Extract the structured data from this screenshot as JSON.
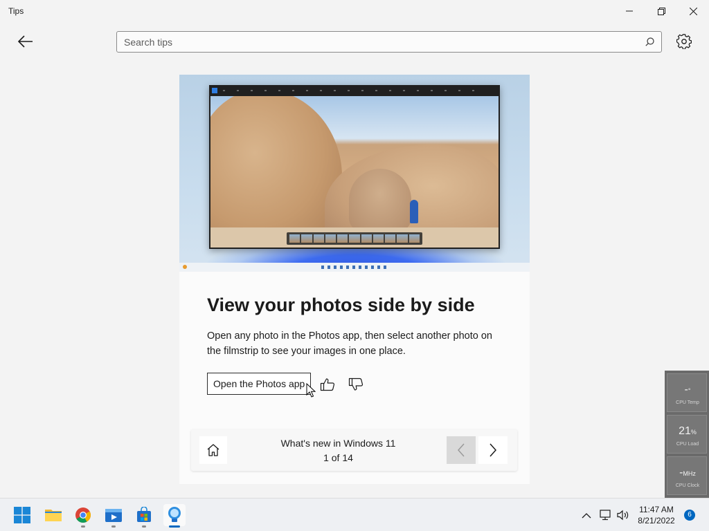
{
  "window": {
    "title": "Tips",
    "minimize_icon": "minimize-icon",
    "restore_icon": "restore-icon",
    "close_icon": "close-icon"
  },
  "appbar": {
    "back_icon": "back-arrow-icon",
    "search_placeholder": "Search tips",
    "search_icon": "search-icon",
    "settings_icon": "gear-icon"
  },
  "card": {
    "hero_image": "photos-app-screenshot",
    "title": "View your photos side by side",
    "description": "Open any photo in the Photos app, then select another photo on the filmstrip to see your images in one place.",
    "action_label": "Open the Photos app",
    "like_icon": "thumbs-up-icon",
    "dislike_icon": "thumbs-down-icon"
  },
  "navigation": {
    "home_icon": "home-icon",
    "collection_title": "What's new in Windows 11",
    "position": "1 of 14",
    "prev_icon": "chevron-left-icon",
    "next_icon": "chevron-right-icon"
  },
  "cpu_gadget": {
    "temp_value": "-",
    "temp_unit": "°",
    "temp_label": "CPU Temp",
    "load_value": "21",
    "load_unit": "%",
    "load_label": "CPU Load",
    "clock_value": "-",
    "clock_unit": "MHz",
    "clock_label": "CPU Clock"
  },
  "taskbar": {
    "apps": [
      {
        "name": "Start",
        "icon": "windows-logo-icon"
      },
      {
        "name": "File Explorer",
        "icon": "folder-icon"
      },
      {
        "name": "Google Chrome",
        "icon": "chrome-icon"
      },
      {
        "name": "Video Editor",
        "icon": "video-editor-icon"
      },
      {
        "name": "Microsoft Store",
        "icon": "store-icon"
      },
      {
        "name": "Tips",
        "icon": "lightbulb-icon"
      }
    ],
    "tray": {
      "chevron_icon": "chevron-up-icon",
      "network_icon": "network-icon",
      "volume_icon": "volume-icon"
    },
    "time": "11:47 AM",
    "date": "8/21/2022",
    "notification_count": "6"
  },
  "colors": {
    "accent": "#0067c0",
    "background": "#f3f3f3",
    "card": "#fbfbfb"
  }
}
